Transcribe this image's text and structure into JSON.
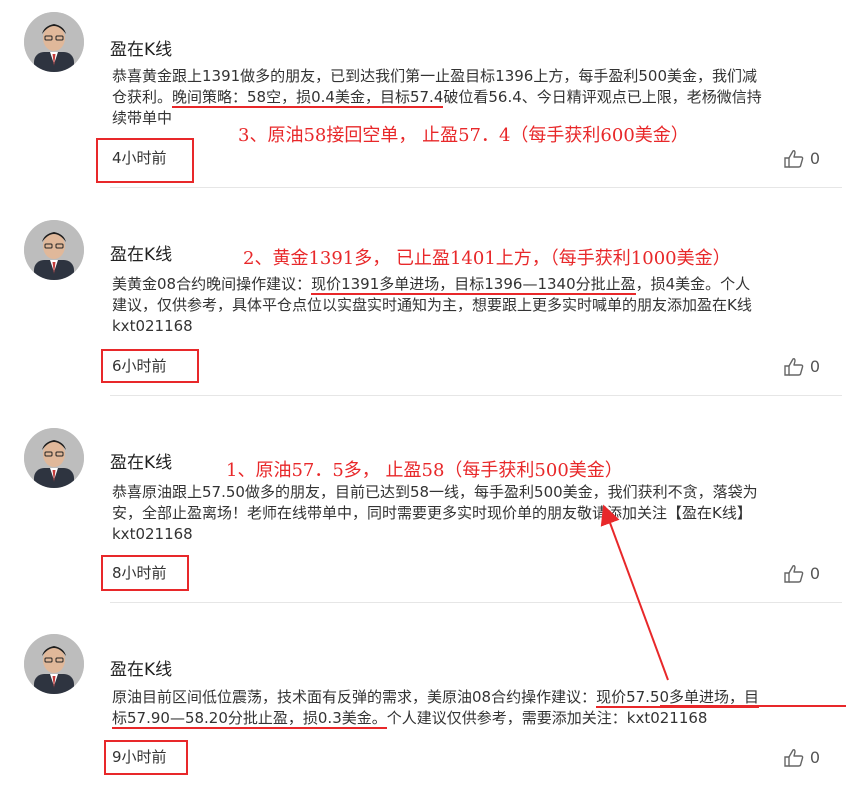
{
  "colors": {
    "annotation": "#e8282a",
    "text": "#333333",
    "divider": "#e6e6e6"
  },
  "posts": [
    {
      "author": "盈在K线",
      "lines": [
        {
          "parts": [
            {
              "t": "恭喜黄金跟上1391做多的朋友，已到达我们第一止盈目标1396上方，每手盈利500美金，我们减"
            }
          ]
        },
        {
          "parts": [
            {
              "t": "仓获利。"
            },
            {
              "t": "晚间策略：58空，损0.4美金，目标57.4",
              "u": true
            },
            {
              "t": "破位看56.4、今日精评观点已上限，老杨微信持"
            }
          ]
        },
        {
          "parts": [
            {
              "t": "续带单中"
            }
          ]
        }
      ],
      "annotation": "3、原油58接回空单， 止盈57．4（每手获利600美金）",
      "time": "4小时前",
      "likes": "0"
    },
    {
      "author": "盈在K线",
      "lines": [
        {
          "parts": [
            {
              "t": "美黄金08合约晚间操作建议："
            },
            {
              "t": "现价1391多单进场，目标1396—1340分批止盈",
              "u": true
            },
            {
              "t": "，损4美金。个人"
            }
          ]
        },
        {
          "parts": [
            {
              "t": "建议，仅供参考，具体平仓点位以实盘实时通知为主，想要跟上更多实时喊单的朋友添加盈在K线"
            }
          ]
        },
        {
          "parts": [
            {
              "t": "kxt021168"
            }
          ]
        }
      ],
      "annotation": "2、黄金1391多， 已止盈1401上方，（每手获利1000美金）",
      "time": "6小时前",
      "likes": "0"
    },
    {
      "author": "盈在K线",
      "lines": [
        {
          "parts": [
            {
              "t": "恭喜原油跟上57.50做多的朋友，目前已达到58一线，每手盈利500美金，我们获利不贪，落袋为"
            }
          ]
        },
        {
          "parts": [
            {
              "t": "安，全部止盈离场！老师在线带单中，同时需要更多实时现价单的朋友敬请添加关注【盈在K线】"
            }
          ]
        },
        {
          "parts": [
            {
              "t": "kxt021168"
            }
          ]
        }
      ],
      "annotation": "1、原油57．5多， 止盈58（每手获利500美金）",
      "time": "8小时前",
      "likes": "0"
    },
    {
      "author": "盈在K线",
      "lines": [
        {
          "parts": [
            {
              "t": "原油目前区间低位震荡，技术面有反弹的需求，美原油08合约操作建议："
            },
            {
              "t": "现价57.50多单进场，目",
              "u": true
            }
          ]
        },
        {
          "parts": [
            {
              "t": "标57.90—58.20分批止盈，损0.3美金。",
              "u": true
            },
            {
              "t": "个人建议仅供参考，需要添加关注：kxt021168"
            }
          ]
        }
      ],
      "annotation": "",
      "time": "9小时前",
      "likes": "0"
    }
  ]
}
